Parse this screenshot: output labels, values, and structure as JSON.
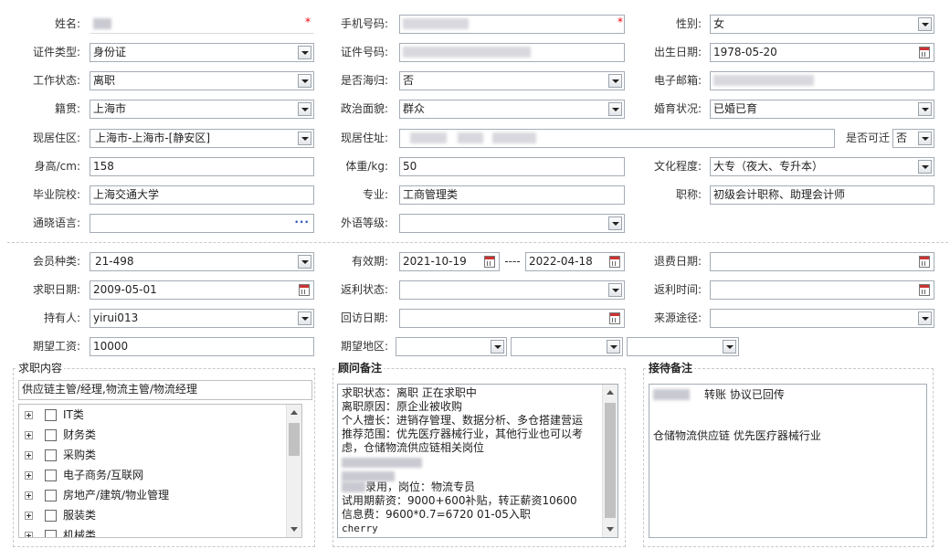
{
  "personal": {
    "name": {
      "label": "姓名:",
      "value": ""
    },
    "mobile": {
      "label": "手机号码:",
      "value": ""
    },
    "gender": {
      "label": "性别:",
      "value": "女"
    },
    "id_type": {
      "label": "证件类型:",
      "value": "身份证"
    },
    "id_number": {
      "label": "证件号码:",
      "value": ""
    },
    "birth_date": {
      "label": "出生日期:",
      "value": "1978-05-20"
    },
    "work_status": {
      "label": "工作状态:",
      "value": "离职"
    },
    "overseas_returnee": {
      "label": "是否海归:",
      "value": "否"
    },
    "email": {
      "label": "电子邮箱:",
      "value": ""
    },
    "native_place": {
      "label": "籍贯:",
      "value": "上海市"
    },
    "political_status": {
      "label": "政治面貌:",
      "value": "群众"
    },
    "marital_status": {
      "label": "婚育状况:",
      "value": "已婚已育"
    },
    "current_area": {
      "label": "现居住区:",
      "value": "上海市-上海市-[静安区]"
    },
    "current_address": {
      "label": "现居住址:",
      "value": ""
    },
    "relocatable": {
      "label": "是否可迁",
      "value": "否"
    },
    "height": {
      "label": "身高/cm:",
      "value": "158"
    },
    "weight": {
      "label": "体重/kg:",
      "value": "50"
    },
    "education": {
      "label": "文化程度:",
      "value": "大专（夜大、专升本）"
    },
    "school": {
      "label": "毕业院校:",
      "value": "上海交通大学"
    },
    "major": {
      "label": "专业:",
      "value": "工商管理类"
    },
    "job_title": {
      "label": "职称:",
      "value": "初级会计职称、助理会计师"
    },
    "language": {
      "label": "通晓语言:",
      "value": "",
      "button": "···"
    },
    "language_level": {
      "label": "外语等级:",
      "value": ""
    }
  },
  "membership": {
    "member_type": {
      "label": "会员种类:",
      "value": "21-498"
    },
    "valid_period": {
      "label": "有效期:",
      "start": "2021-10-19",
      "separator": "----",
      "end": "2022-04-18"
    },
    "refund_date": {
      "label": "退费日期:",
      "value": ""
    },
    "job_seek_date": {
      "label": "求职日期:",
      "value": "2009-05-01"
    },
    "rebate_status": {
      "label": "返利状态:",
      "value": ""
    },
    "rebate_time": {
      "label": "返利时间:",
      "value": ""
    },
    "holder": {
      "label": "持有人:",
      "value": "yirui013"
    },
    "revisit_date": {
      "label": "回访日期:",
      "value": ""
    },
    "source": {
      "label": "来源途径:",
      "value": ""
    },
    "expected_salary": {
      "label": "期望工资:",
      "value": "10000"
    },
    "expected_region": {
      "label": "期望地区:",
      "values": [
        "",
        "",
        ""
      ]
    }
  },
  "job_content": {
    "title": "求职内容",
    "selected": "供应链主管/经理,物流主管/物流经理",
    "categories": [
      "IT类",
      "财务类",
      "采购类",
      "电子商务/互联网",
      "房地产/建筑/物业管理",
      "服装类",
      "机械类"
    ]
  },
  "advisor_notes": {
    "title": "顾问备注",
    "lines": [
      "求职状态：离职 正在求职中",
      "离职原因：原企业被收购",
      "个人擅长：进销存管理、数据分析、多仓搭建营运",
      "推荐范围：优先医疗器械行业，其他行业也可以考虑，仓储物流供应链相关岗位",
      "录用，岗位：物流专员",
      "试用期薪资：9000+600补贴，转正薪资10600",
      "信息费：9600*0.7=6720 01-05入职",
      "cherry"
    ]
  },
  "reception_notes": {
    "title": "接待备注",
    "line1": "转账  协议已回传",
    "line2": "仓储物流供应链    优先医疗器械行业"
  }
}
